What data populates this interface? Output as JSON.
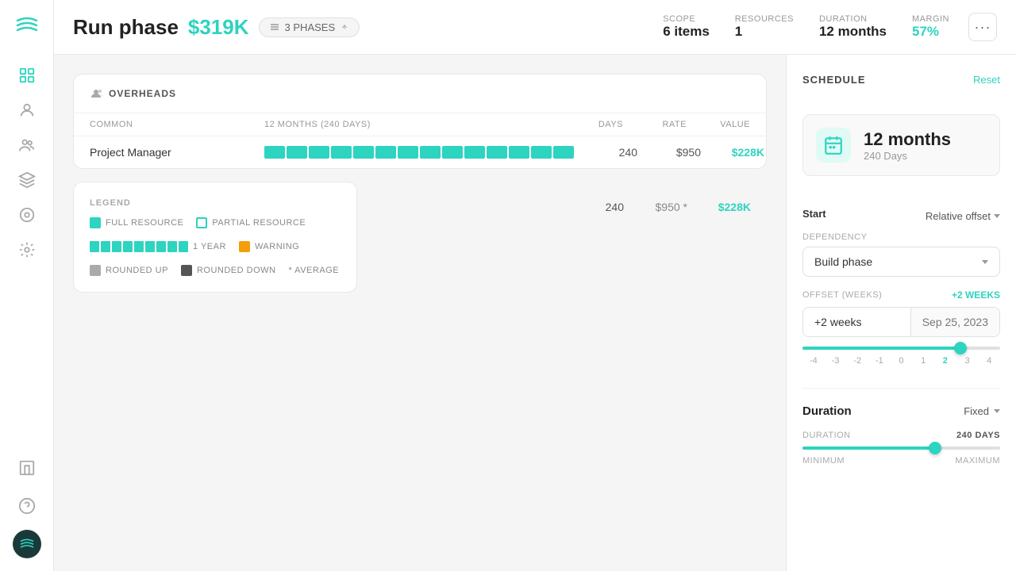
{
  "app": {
    "logo_symbol": "≋"
  },
  "sidebar": {
    "icons": [
      {
        "name": "grid-icon",
        "symbol": "⊞"
      },
      {
        "name": "users-icon",
        "symbol": "👤"
      },
      {
        "name": "team-icon",
        "symbol": "👥"
      },
      {
        "name": "box-icon",
        "symbol": "⬡"
      },
      {
        "name": "brain-icon",
        "symbol": "◎"
      },
      {
        "name": "settings-icon",
        "symbol": "⚙"
      },
      {
        "name": "building-icon",
        "symbol": "🏢"
      },
      {
        "name": "help-icon",
        "symbol": "?"
      }
    ]
  },
  "header": {
    "title": "Run phase",
    "price": "$319K",
    "phases_label": "3 PHASES",
    "scope_label": "SCOPE",
    "scope_value": "6 items",
    "resources_label": "RESOURCES",
    "resources_value": "1",
    "duration_label": "DURATION",
    "duration_value": "12 months",
    "margin_label": "MARGIN",
    "margin_value": "57%",
    "more_button": "···"
  },
  "overheads": {
    "title": "OVERHEADS",
    "columns": {
      "common": "COMMON",
      "months": "12 MONTHS (240 DAYS)",
      "days": "DAYS",
      "rate": "RATE",
      "value": "VALUE"
    },
    "rows": [
      {
        "name": "Project Manager",
        "bars": 14,
        "days": "240",
        "rate": "$950",
        "value": "$228K"
      }
    ],
    "totals": {
      "days": "240",
      "rate": "$950 *",
      "value": "$228K"
    }
  },
  "legend": {
    "title": "LEGEND",
    "items": [
      {
        "key": "full-resource",
        "label": "FULL RESOURCE"
      },
      {
        "key": "partial-resource",
        "label": "PARTIAL RESOURCE"
      },
      {
        "key": "1-year",
        "label": "1 YEAR"
      },
      {
        "key": "warning",
        "label": "WARNING"
      },
      {
        "key": "rounded-up",
        "label": "ROUNDED UP"
      },
      {
        "key": "rounded-down",
        "label": "ROUNDED DOWN"
      },
      {
        "key": "average",
        "label": "* AVERAGE"
      }
    ]
  },
  "schedule": {
    "panel_title": "SCHEDULE",
    "reset_label": "Reset",
    "duration_months": "12 months",
    "duration_days": "240 Days",
    "start_label": "Start",
    "relative_offset_label": "Relative offset",
    "dependency_label": "DEPENDENCY",
    "dependency_value": "Build phase",
    "offset_label": "OFFSET (WEEKS)",
    "offset_badge": "+2 WEEKS",
    "offset_weeks": "+2 weeks",
    "offset_date": "Sep 25, 2023",
    "slider_labels": [
      "-4",
      "-3",
      "-2",
      "-1",
      "0",
      "1",
      "2",
      "3",
      "4"
    ],
    "slider_active": "2",
    "slider_position_pct": 80,
    "duration_title": "Duration",
    "duration_type": "Fixed",
    "duration_meta_label": "DURATION",
    "duration_meta_value": "240 DAYS",
    "duration_slider_pct": 67,
    "minimum_label": "MINIMUM",
    "maximum_label": "MAXIMUM"
  }
}
